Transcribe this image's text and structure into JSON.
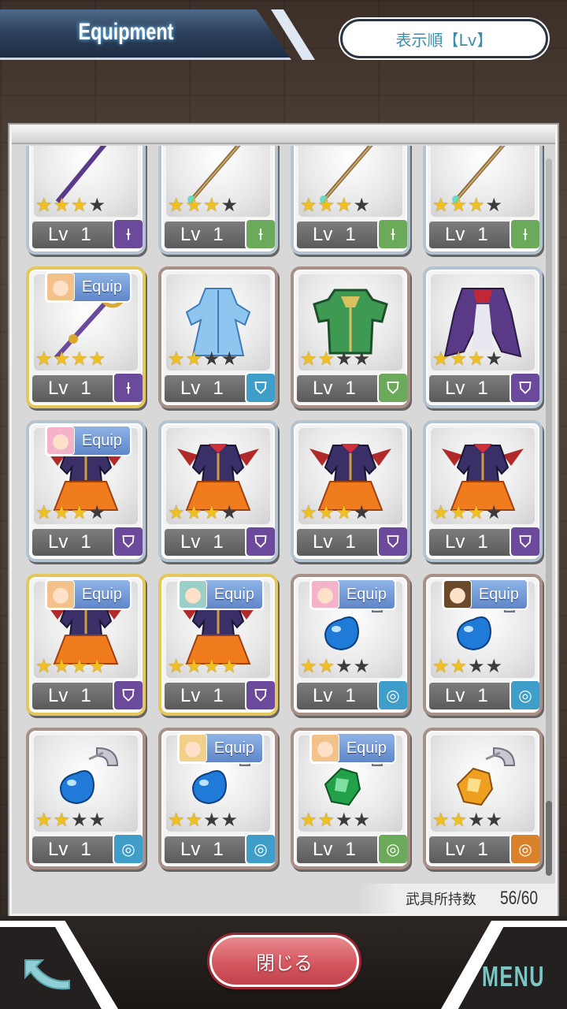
{
  "header": {
    "title": "Equipment",
    "sort_label": "表示順【Lv】"
  },
  "footer": {
    "owned_label": "武具所持数",
    "owned_count": "56/60",
    "close_label": "閉じる",
    "menu_label": "MENU"
  },
  "grid": {
    "rows": [
      [
        {
          "art": "staff-purple-icon",
          "stars": 3,
          "max_stars": 4,
          "lv_label": "Lv",
          "level": "1",
          "type": "staff",
          "badge_color": "purple",
          "frame": "silver",
          "equip_label": ""
        },
        {
          "art": "staff-wood-icon",
          "stars": 3,
          "max_stars": 4,
          "lv_label": "Lv",
          "level": "1",
          "type": "staff",
          "badge_color": "green",
          "frame": "silver",
          "equip_label": ""
        },
        {
          "art": "staff-wood-icon",
          "stars": 3,
          "max_stars": 4,
          "lv_label": "Lv",
          "level": "1",
          "type": "staff",
          "badge_color": "green",
          "frame": "silver",
          "equip_label": ""
        },
        {
          "art": "staff-wood-icon",
          "stars": 3,
          "max_stars": 4,
          "lv_label": "Lv",
          "level": "1",
          "type": "staff",
          "badge_color": "green",
          "frame": "silver",
          "equip_label": ""
        }
      ],
      [
        {
          "art": "staff-gold-icon",
          "stars": 4,
          "max_stars": 4,
          "lv_label": "Lv",
          "level": "1",
          "type": "staff",
          "badge_color": "purple",
          "frame": "gold",
          "equip_label": "Equip"
        },
        {
          "art": "dress-blue-icon",
          "stars": 2,
          "max_stars": 4,
          "lv_label": "Lv",
          "level": "1",
          "type": "armor",
          "badge_color": "blue",
          "frame": "bronze",
          "equip_label": ""
        },
        {
          "art": "armor-green-icon",
          "stars": 2,
          "max_stars": 4,
          "lv_label": "Lv",
          "level": "1",
          "type": "armor",
          "badge_color": "green",
          "frame": "bronze",
          "equip_label": ""
        },
        {
          "art": "coat-purple-icon",
          "stars": 3,
          "max_stars": 4,
          "lv_label": "Lv",
          "level": "1",
          "type": "armor",
          "badge_color": "purple",
          "frame": "silver",
          "equip_label": ""
        }
      ],
      [
        {
          "art": "dress-halloween-icon",
          "stars": 3,
          "max_stars": 4,
          "lv_label": "Lv",
          "level": "1",
          "type": "armor",
          "badge_color": "purple",
          "frame": "silver",
          "equip_label": "Equip"
        },
        {
          "art": "dress-halloween-icon",
          "stars": 3,
          "max_stars": 4,
          "lv_label": "Lv",
          "level": "1",
          "type": "armor",
          "badge_color": "purple",
          "frame": "silver",
          "equip_label": ""
        },
        {
          "art": "dress-halloween-icon",
          "stars": 3,
          "max_stars": 4,
          "lv_label": "Lv",
          "level": "1",
          "type": "armor",
          "badge_color": "purple",
          "frame": "silver",
          "equip_label": ""
        },
        {
          "art": "dress-halloween-icon",
          "stars": 3,
          "max_stars": 4,
          "lv_label": "Lv",
          "level": "1",
          "type": "armor",
          "badge_color": "purple",
          "frame": "silver",
          "equip_label": ""
        }
      ],
      [
        {
          "art": "dress-halloween-icon",
          "stars": 4,
          "max_stars": 4,
          "lv_label": "Lv",
          "level": "1",
          "type": "armor",
          "badge_color": "purple",
          "frame": "gold",
          "equip_label": "Equip"
        },
        {
          "art": "dress-halloween-icon",
          "stars": 4,
          "max_stars": 4,
          "lv_label": "Lv",
          "level": "1",
          "type": "armor",
          "badge_color": "purple",
          "frame": "gold",
          "equip_label": "Equip"
        },
        {
          "art": "earring-blue-icon",
          "stars": 2,
          "max_stars": 4,
          "lv_label": "Lv",
          "level": "1",
          "type": "accessory",
          "badge_color": "blue",
          "frame": "bronze",
          "equip_label": "Equip"
        },
        {
          "art": "earring-blue-icon",
          "stars": 2,
          "max_stars": 4,
          "lv_label": "Lv",
          "level": "1",
          "type": "accessory",
          "badge_color": "blue",
          "frame": "bronze",
          "equip_label": "Equip"
        }
      ],
      [
        {
          "art": "earring-blue-icon",
          "stars": 2,
          "max_stars": 4,
          "lv_label": "Lv",
          "level": "1",
          "type": "accessory",
          "badge_color": "blue",
          "frame": "bronze",
          "equip_label": ""
        },
        {
          "art": "earring-blue-icon",
          "stars": 2,
          "max_stars": 4,
          "lv_label": "Lv",
          "level": "1",
          "type": "accessory",
          "badge_color": "blue",
          "frame": "bronze",
          "equip_label": "Equip"
        },
        {
          "art": "earring-green-icon",
          "stars": 2,
          "max_stars": 4,
          "lv_label": "Lv",
          "level": "1",
          "type": "accessory",
          "badge_color": "green",
          "frame": "bronze",
          "equip_label": "Equip"
        },
        {
          "art": "earring-orange-icon",
          "stars": 2,
          "max_stars": 4,
          "lv_label": "Lv",
          "level": "1",
          "type": "accessory",
          "badge_color": "orange",
          "frame": "bronze",
          "equip_label": ""
        }
      ]
    ]
  },
  "colors": {
    "accent": "#3a8ea8",
    "close": "#d55861",
    "menu": "#7cc6c6"
  }
}
